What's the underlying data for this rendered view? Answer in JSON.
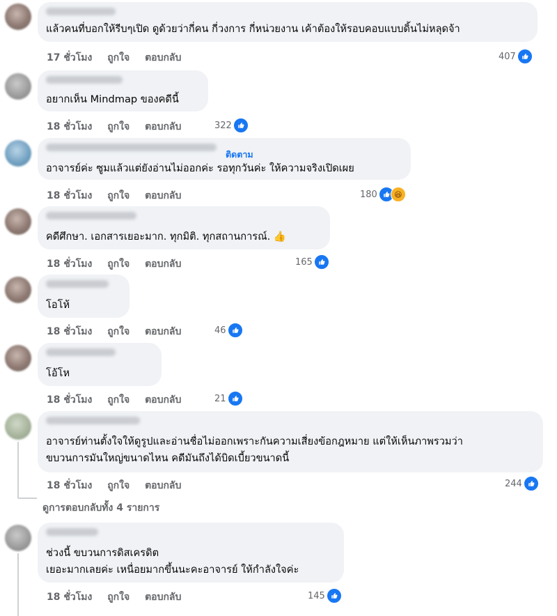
{
  "actions": {
    "like": "ถูกใจ",
    "reply": "ตอบกลับ"
  },
  "comments": [
    {
      "time": "17 ชั่วโมง",
      "text": [
        "แล้วคนที่บอกให้รีบๆเปิด ดูด้วยว่ากี่คน กี่วงการ กี่หน่วยงาน เค้าต้องให้รอบคอบแบบดิ้นไม่หลุดจ้า"
      ],
      "reactions": "407"
    },
    {
      "time": "18 ชั่วโมง",
      "text": [
        "อยากเห็น Mindmap ของคดีนี้"
      ],
      "reactions": "322"
    },
    {
      "time": "18 ชั่วโมง",
      "follow": "ติดตาม",
      "text": [
        "อาจารย์ค่ะ ซูมแล้วแต่ยังอ่านไม่ออกค่ะ รอทุกวันค่ะ ให้ความจริงเปิดเผย"
      ],
      "reactions": "180"
    },
    {
      "time": "18 ชั่วโมง",
      "text": [
        "คดีศึกษา. เอกสารเยอะมาก. ทุกมิติ. ทุกสถานการณ์. 👍"
      ],
      "reactions": "165"
    },
    {
      "time": "18 ชั่วโมง",
      "text": [
        "โอโห้"
      ],
      "reactions": "46"
    },
    {
      "time": "18 ชั่วโมง",
      "text": [
        "โอ้โห"
      ],
      "reactions": "21"
    },
    {
      "time": "18 ชั่วโมง",
      "text": [
        "อาจารย์ท่านตั้งใจให้ดูรูปและอ่านชื่อไม่ออกเพราะกันความเสี่ยงข้อกฎหมาย แต่ให้เห็นภาพรวมว่า",
        "ขบวนการมันใหญ่ขนาดไหน คดีมันถึงได้บิดเบี้ยวขนาดนี้"
      ],
      "reactions": "244",
      "view_replies": "ดูการตอบกลับทั้ง 4 รายการ"
    },
    {
      "time": "18 ชั่วโมง",
      "text": [
        "ช่วงนี้ ขบวนการดิสเครดิต",
        "เยอะมากเลยค่ะ เหนื่อยมากขึ้นนะคะอาจารย์ ให้กำลังใจค่ะ"
      ],
      "reactions": "145"
    }
  ],
  "icons": {
    "like": "like-reaction-icon",
    "haha": "haha-reaction-icon"
  }
}
